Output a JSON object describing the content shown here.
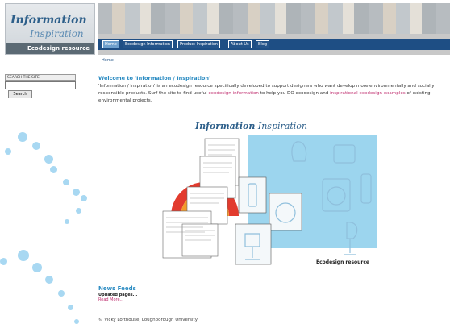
{
  "logo": {
    "line1": "Information",
    "line2": "Inspiration",
    "tagline": "Ecodesign resource"
  },
  "nav": [
    "Home",
    "Ecodesign Information",
    "Product Inspiration",
    "About Us",
    "Blog"
  ],
  "breadcrumb": "Home",
  "search": {
    "label": "SEARCH THE SITE",
    "button": "Search"
  },
  "welcome": {
    "title": "Welcome to 'Information / Inspiration'",
    "text1": "'Information / Inspiration' is an ecodesign resource specifically developed to support designers who want develop more environmentally and socially responsible products. Surf the site to find useful ",
    "link1": "ecodesign information",
    "text2": " to help you DO ecodesign and ",
    "link2": "inspirational ecodesign examples",
    "text3": " of existing environmental projects."
  },
  "figure": {
    "title_a": "Information",
    "title_b": " Inspiration",
    "caption": "Ecodesign resource"
  },
  "news": {
    "title": "News Feeds",
    "updated": "Updated pages...",
    "more": "Read More..."
  },
  "footer": "© Vicky Lofthouse, Loughborough University",
  "colors": {
    "nav": "#1e4e84",
    "accent": "#2a8bc2",
    "link": "#c03070",
    "panel": "#9cd5ee"
  }
}
